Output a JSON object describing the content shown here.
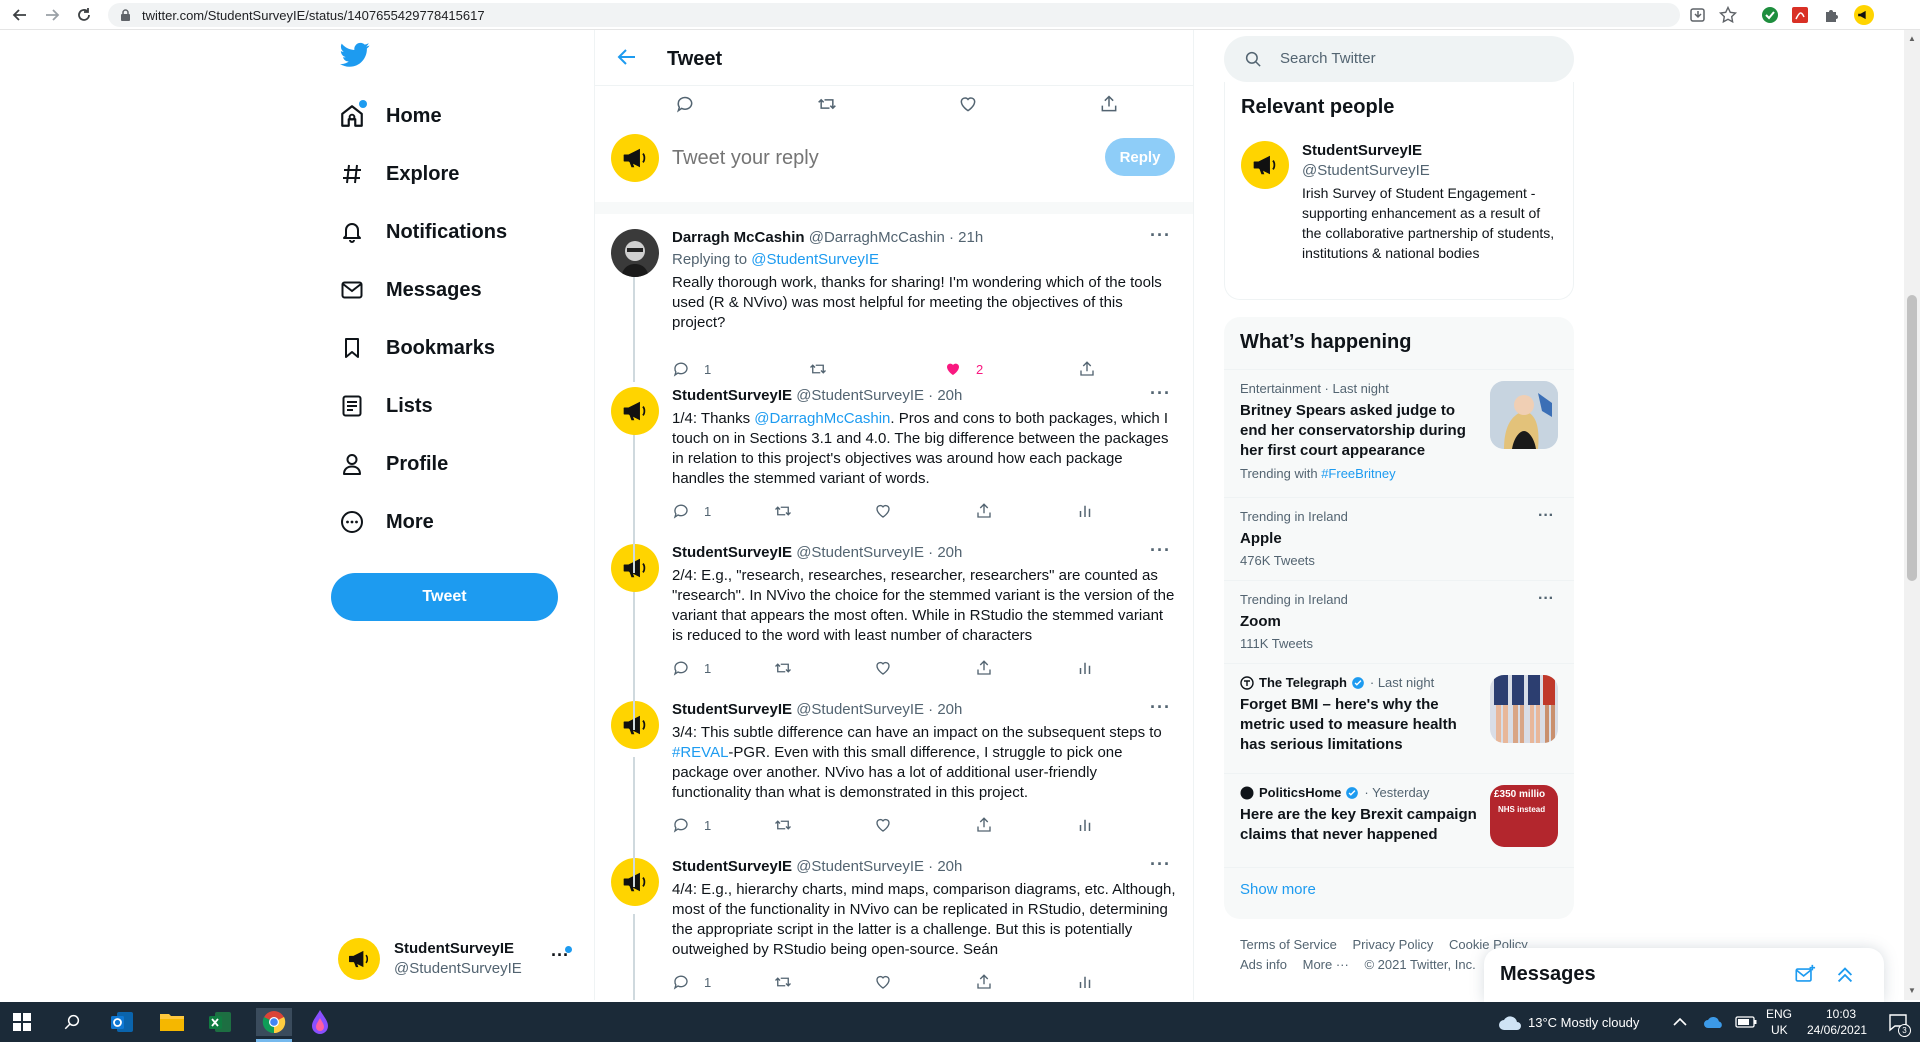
{
  "browser": {
    "url": "twitter.com/StudentSurveyIE/status/1407655429778415617"
  },
  "nav": {
    "items": [
      {
        "label": "Home",
        "icon": "home-icon"
      },
      {
        "label": "Explore",
        "icon": "hashtag-icon"
      },
      {
        "label": "Notifications",
        "icon": "bell-icon"
      },
      {
        "label": "Messages",
        "icon": "envelope-icon"
      },
      {
        "label": "Bookmarks",
        "icon": "bookmark-icon"
      },
      {
        "label": "Lists",
        "icon": "list-icon"
      },
      {
        "label": "Profile",
        "icon": "person-icon"
      },
      {
        "label": "More",
        "icon": "more-circle-icon"
      }
    ],
    "tweet_button": "Tweet",
    "account": {
      "name": "StudentSurveyIE",
      "handle": "@StudentSurveyIE"
    }
  },
  "main": {
    "title": "Tweet",
    "reply_placeholder": "Tweet your reply",
    "reply_button": "Reply",
    "tweets": [
      {
        "name": "Darragh McCashin",
        "handle": "@DarraghMcCashin",
        "time": "· 21h",
        "replying_prefix": "Replying to",
        "replying_to": "@StudentSurveyIE",
        "text": "Really thorough work, thanks for sharing! I'm wondering which of the tools used (R & NVivo) was most helpful for meeting the objectives of this project?",
        "replies": "1",
        "likes": "2"
      },
      {
        "name": "StudentSurveyIE",
        "handle": "@StudentSurveyIE",
        "time": "· 20h",
        "text_pre": "1/4: Thanks ",
        "text_link": "@DarraghMcCashin",
        "text_post": ". Pros and cons to both packages, which I touch on in Sections 3.1 and 4.0.  The big difference between the packages in relation to this project's objectives was around how each package handles the stemmed variant of words.",
        "replies": "1"
      },
      {
        "name": "StudentSurveyIE",
        "handle": "@StudentSurveyIE",
        "time": "· 20h",
        "text": "2/4: E.g., \"research, researches, researcher, researchers\" are counted as \"research\". In NVivo the choice for the stemmed variant is the version of the variant that appears the most often. While in RStudio the stemmed variant is reduced to the word with least number of characters",
        "replies": "1"
      },
      {
        "name": "StudentSurveyIE",
        "handle": "@StudentSurveyIE",
        "time": "· 20h",
        "text_pre": "3/4: This subtle difference can have an impact on the subsequent steps to ",
        "text_link": "#REVAL",
        "text_post": "-PGR. Even with this small difference, I struggle to pick one package over another. NVivo has a lot of additional user-friendly functionality than what is demonstrated in this project.",
        "replies": "1"
      },
      {
        "name": "StudentSurveyIE",
        "handle": "@StudentSurveyIE",
        "time": "· 20h",
        "text": "4/4: E.g., hierarchy charts, mind maps, comparison diagrams, etc. Although, most of the functionality in NVivo can be replicated in RStudio, determining the appropriate script in the latter is a challenge. But this is potentially outweighed by RStudio being open-source. Seán",
        "replies": "1"
      }
    ]
  },
  "right": {
    "search_placeholder": "Search Twitter",
    "relevant": {
      "title": "Relevant people",
      "name": "StudentSurveyIE",
      "handle": "@StudentSurveyIE",
      "bio": "Irish Survey of Student Engagement - supporting enhancement as a result of the collaborative partnership of students, institutions & national bodies"
    },
    "happening": {
      "title": "What’s happening",
      "t1_meta": "Entertainment · Last night",
      "t1_title": "Britney Spears asked judge to end her conservatorship during her first court appearance",
      "t1_sub_prefix": "Trending with",
      "t1_sub_link": "#FreeBritney",
      "t2_meta": "Trending in Ireland",
      "t2_title": "Apple",
      "t2_sub": "476K Tweets",
      "t3_meta": "Trending in Ireland",
      "t3_title": "Zoom",
      "t3_sub": "111K Tweets",
      "t4_source": "The Telegraph",
      "t4_time": "· Last night",
      "t4_title": "Forget BMI – here's why the metric used to measure health has serious limitations",
      "t5_source": "PoliticsHome",
      "t5_time": "· Yesterday",
      "t5_title": "Here are the key Brexit campaign claims that never happened",
      "t5_thumb_text": "£350 millio",
      "t5_thumb_text2": "NHS instead",
      "show_more": "Show more"
    },
    "footer": {
      "terms": "Terms of Service",
      "privacy": "Privacy Policy",
      "cookie": "Cookie Policy",
      "ads": "Ads info",
      "more": "More ···",
      "copyright": "© 2021 Twitter, Inc."
    },
    "messages_drawer": "Messages"
  },
  "taskbar": {
    "weather": "13°C  Mostly cloudy",
    "lang1": "ENG",
    "lang2": "UK",
    "time": "10:03",
    "date": "24/06/2021",
    "notif_count": "3"
  },
  "colors": {
    "accent": "#1d9bf0",
    "like": "#f91880",
    "avatar_yellow": "#ffd400"
  }
}
